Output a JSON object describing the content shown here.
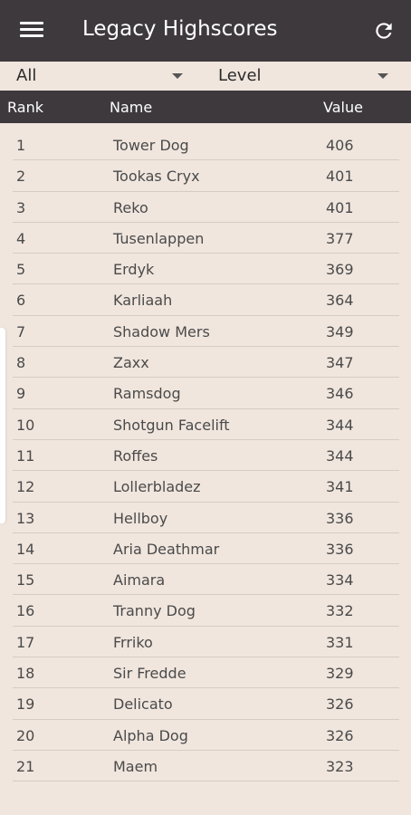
{
  "appbar": {
    "title": "Legacy Highscores",
    "menu_icon": "menu-icon",
    "refresh_icon": "refresh-icon"
  },
  "filters": {
    "category": "All",
    "sort": "Level"
  },
  "table": {
    "headers": {
      "rank": "Rank",
      "name": "Name",
      "value": "Value"
    },
    "rows": [
      {
        "rank": "1",
        "name": "Tower Dog",
        "value": "406"
      },
      {
        "rank": "2",
        "name": "Tookas Cryx",
        "value": "401"
      },
      {
        "rank": "3",
        "name": "Reko",
        "value": "401"
      },
      {
        "rank": "4",
        "name": "Tusenlappen",
        "value": "377"
      },
      {
        "rank": "5",
        "name": "Erdyk",
        "value": "369"
      },
      {
        "rank": "6",
        "name": "Karliaah",
        "value": "364"
      },
      {
        "rank": "7",
        "name": "Shadow Mers",
        "value": "349"
      },
      {
        "rank": "8",
        "name": "Zaxx",
        "value": "347"
      },
      {
        "rank": "9",
        "name": "Ramsdog",
        "value": "346"
      },
      {
        "rank": "10",
        "name": "Shotgun Facelift",
        "value": "344"
      },
      {
        "rank": "11",
        "name": "Roffes",
        "value": "344"
      },
      {
        "rank": "12",
        "name": "Lollerbladez",
        "value": "341"
      },
      {
        "rank": "13",
        "name": "Hellboy",
        "value": "336"
      },
      {
        "rank": "14",
        "name": "Aria Deathmar",
        "value": "336"
      },
      {
        "rank": "15",
        "name": "Aimara",
        "value": "334"
      },
      {
        "rank": "16",
        "name": "Tranny Dog",
        "value": "332"
      },
      {
        "rank": "17",
        "name": "Frriko",
        "value": "331"
      },
      {
        "rank": "18",
        "name": "Sir Fredde",
        "value": "329"
      },
      {
        "rank": "19",
        "name": "Delicato",
        "value": "326"
      },
      {
        "rank": "20",
        "name": "Alpha Dog",
        "value": "326"
      },
      {
        "rank": "21",
        "name": "Maem",
        "value": "323"
      }
    ]
  },
  "colors": {
    "appbar": "#3e393d",
    "background": "#f0e6de",
    "divider": "#d6ccc4"
  }
}
